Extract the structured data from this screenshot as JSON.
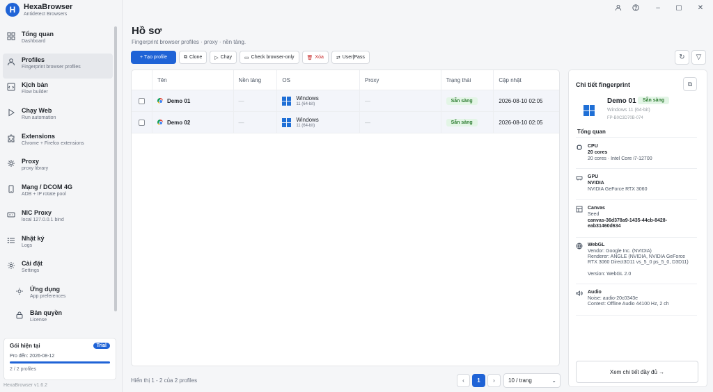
{
  "brand": {
    "logo_letter": "H",
    "title": "HexaBrowser",
    "subtitle": "Antidetect Browsers"
  },
  "sidebar": {
    "items": [
      {
        "label": "Tổng quan",
        "desc": "Dashboard",
        "icon": "grid-icon"
      },
      {
        "label": "Profiles",
        "desc": "Fingerprint browser profiles",
        "icon": "user-icon",
        "active": true
      },
      {
        "label": "Kịch bản",
        "desc": "Flow builder",
        "icon": "code-icon"
      },
      {
        "label": "Chạy Web",
        "desc": "Run automation",
        "icon": "play-icon"
      },
      {
        "label": "Extensions",
        "desc": "Chrome + Firefox extensions",
        "icon": "puzzle-icon"
      },
      {
        "label": "Proxy",
        "desc": "proxy library",
        "icon": "proxy-icon"
      },
      {
        "label": "Mạng / DCOM 4G",
        "desc": "ADB + IP rotate pool",
        "icon": "phone-icon"
      },
      {
        "label": "NIC Proxy",
        "desc": "local 127.0.0.1 bind",
        "icon": "nic-icon"
      },
      {
        "label": "Nhật ký",
        "desc": "Logs",
        "icon": "list-icon"
      },
      {
        "label": "Cài đặt",
        "desc": "Settings",
        "icon": "gear-icon"
      }
    ],
    "sub_items": [
      {
        "label": "Ứng dụng",
        "desc": "App preferences",
        "icon": "sun-icon"
      },
      {
        "label": "Bản quyền",
        "desc": "License",
        "icon": "lock-icon"
      }
    ],
    "plan": {
      "title": "Gói hiện tại",
      "badge": "Trial",
      "expiry": "Pro đến: 2026-08-12",
      "count": "2 / 2 profiles",
      "usage_fraction": 1.0
    },
    "version": "HexaBrowser v1.6.2"
  },
  "window": {
    "account_icon": "person-icon",
    "help_icon": "help-icon",
    "minimize": "–",
    "maximize": "▢",
    "close": "✕"
  },
  "page": {
    "title": "Hồ sơ",
    "subtitle": "Fingerprint browser profiles · proxy · nền tảng."
  },
  "toolbar": {
    "create": "+ Tạo profile",
    "clone": "Clone",
    "run": "Chạy",
    "check": "Check browser-only",
    "delete": "Xóa",
    "userpass": "User|Pass"
  },
  "table": {
    "headers": {
      "name": "Tên",
      "platform": "Nền tảng",
      "os": "OS",
      "proxy": "Proxy",
      "status": "Trạng thái",
      "updated": "Cập nhật"
    },
    "rows": [
      {
        "name": "Demo 01",
        "platform": "—",
        "os_name": "Windows",
        "os_ver": "11 (64-bit)",
        "proxy": "—",
        "status": "Sẵn sàng",
        "updated": "2026-08-10 02:05"
      },
      {
        "name": "Demo 02",
        "platform": "—",
        "os_name": "Windows",
        "os_ver": "11 (64-bit)",
        "proxy": "—",
        "status": "Sẵn sàng",
        "updated": "2026-08-10 02:05"
      }
    ]
  },
  "footer": {
    "info": "Hiển thị 1 - 2 của 2 profiles",
    "prev": "‹",
    "page": "1",
    "next": "›",
    "per_page": "10 / trang"
  },
  "detail": {
    "title": "Chi tiết fingerprint",
    "name": "Demo 01",
    "status": "Sẵn sàng",
    "os": "Windows 11 (64-bit)",
    "fp_id": "FP-B0C3D70B-074",
    "section": "Tổng quan",
    "cpu": {
      "label": "CPU",
      "value": "20 cores",
      "detail": "20 cores · Intel Core i7-12700"
    },
    "gpu": {
      "label": "GPU",
      "value": "NVIDIA",
      "detail": "NVIDIA GeForce RTX 3060"
    },
    "canvas": {
      "label": "Canvas",
      "line1": "Seed",
      "line2": "canvas-36d378a9-1435-44cb-8428-eab31460d634"
    },
    "webgl": {
      "label": "WebGL",
      "vendor": "Vendor: Google Inc. (NVIDIA)",
      "renderer": "Renderer: ANGLE (NVIDIA, NVIDIA GeForce RTX 3060 Direct3D11 vs_5_0 ps_5_0, D3D11)",
      "version": "Version: WebGL 2.0"
    },
    "audio": {
      "label": "Audio",
      "noise": "Noise: audio-20c0343e",
      "context": "Context: Offline Audio 44100 Hz, 2 ch"
    },
    "more": "Xem chi tiết đầy đủ →"
  },
  "colors": {
    "accent": "#1f63d6",
    "ready_bg": "#e3f5e6",
    "ready_fg": "#2e7d32",
    "danger": "#c62828"
  }
}
